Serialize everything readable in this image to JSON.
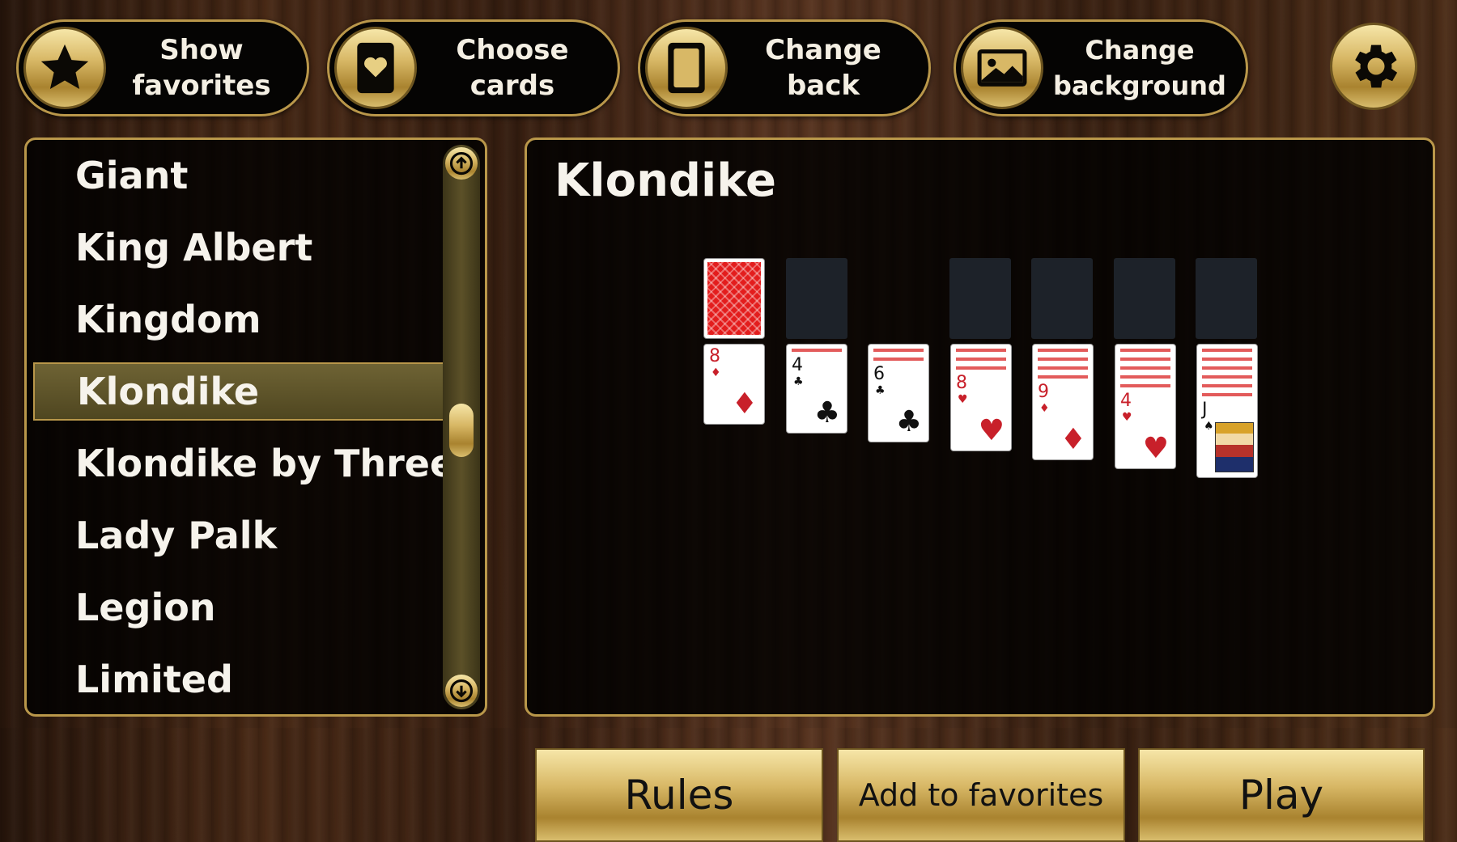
{
  "toolbar": {
    "show_favorites": "Show\nfavorites",
    "choose_cards": "Choose\ncards",
    "change_back": "Change\nback",
    "change_background": "Change\nbackground"
  },
  "game_list": {
    "items": [
      "Giant",
      "King Albert",
      "Kingdom",
      "Klondike",
      "Klondike by Threes",
      "Lady Palk",
      "Legion",
      "Limited"
    ],
    "selected": "Klondike"
  },
  "preview": {
    "title": "Klondike",
    "columns": [
      {
        "rank": "8",
        "suit": "diamond",
        "color": "red",
        "face_down": 0
      },
      {
        "rank": "4",
        "suit": "club",
        "color": "black",
        "face_down": 1
      },
      {
        "rank": "6",
        "suit": "club",
        "color": "black",
        "face_down": 2
      },
      {
        "rank": "8",
        "suit": "heart",
        "color": "red",
        "face_down": 3
      },
      {
        "rank": "9",
        "suit": "diamond",
        "color": "red",
        "face_down": 4
      },
      {
        "rank": "4",
        "suit": "heart",
        "color": "red",
        "face_down": 5
      },
      {
        "rank": "J",
        "suit": "spade",
        "color": "black",
        "face_down": 6
      }
    ]
  },
  "actions": {
    "rules": "Rules",
    "add_favorites": "Add to favorites",
    "play": "Play"
  },
  "colors": {
    "gold": "#d8b866",
    "panel": "#000000",
    "card_back": "#e31d1d"
  }
}
